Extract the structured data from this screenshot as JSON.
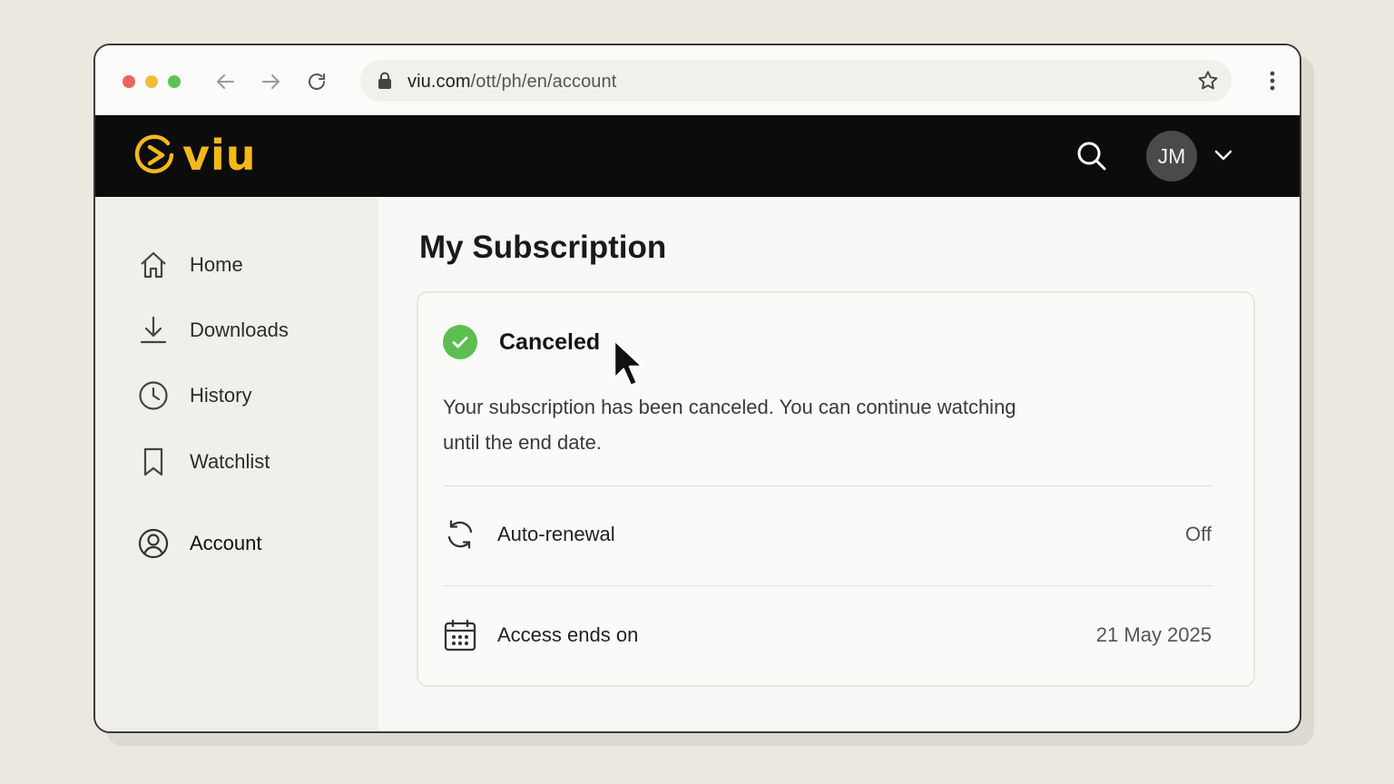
{
  "browser": {
    "url_host": "viu.com",
    "url_path": "/ott/ph/en/account"
  },
  "header": {
    "logo_text": "viu",
    "brand_color": "#f4b81c",
    "avatar_initials": "JM"
  },
  "sidebar": {
    "items": [
      {
        "label": "Home",
        "icon": "home-icon"
      },
      {
        "label": "Downloads",
        "icon": "download-icon"
      },
      {
        "label": "History",
        "icon": "clock-icon"
      },
      {
        "label": "Watchlist",
        "icon": "bookmark-icon"
      },
      {
        "label": "Account",
        "icon": "user-circle-icon",
        "active": true
      }
    ]
  },
  "main": {
    "title": "My Subscription",
    "status": {
      "label": "Canceled",
      "color": "#5cbf50",
      "description": "Your subscription has been canceled. You can continue watching until the end date."
    },
    "rows": [
      {
        "label": "Auto-renewal",
        "value": "Off",
        "icon": "refresh-icon"
      },
      {
        "label": "Access ends on",
        "value": "21 May 2025",
        "icon": "calendar-icon"
      }
    ]
  }
}
